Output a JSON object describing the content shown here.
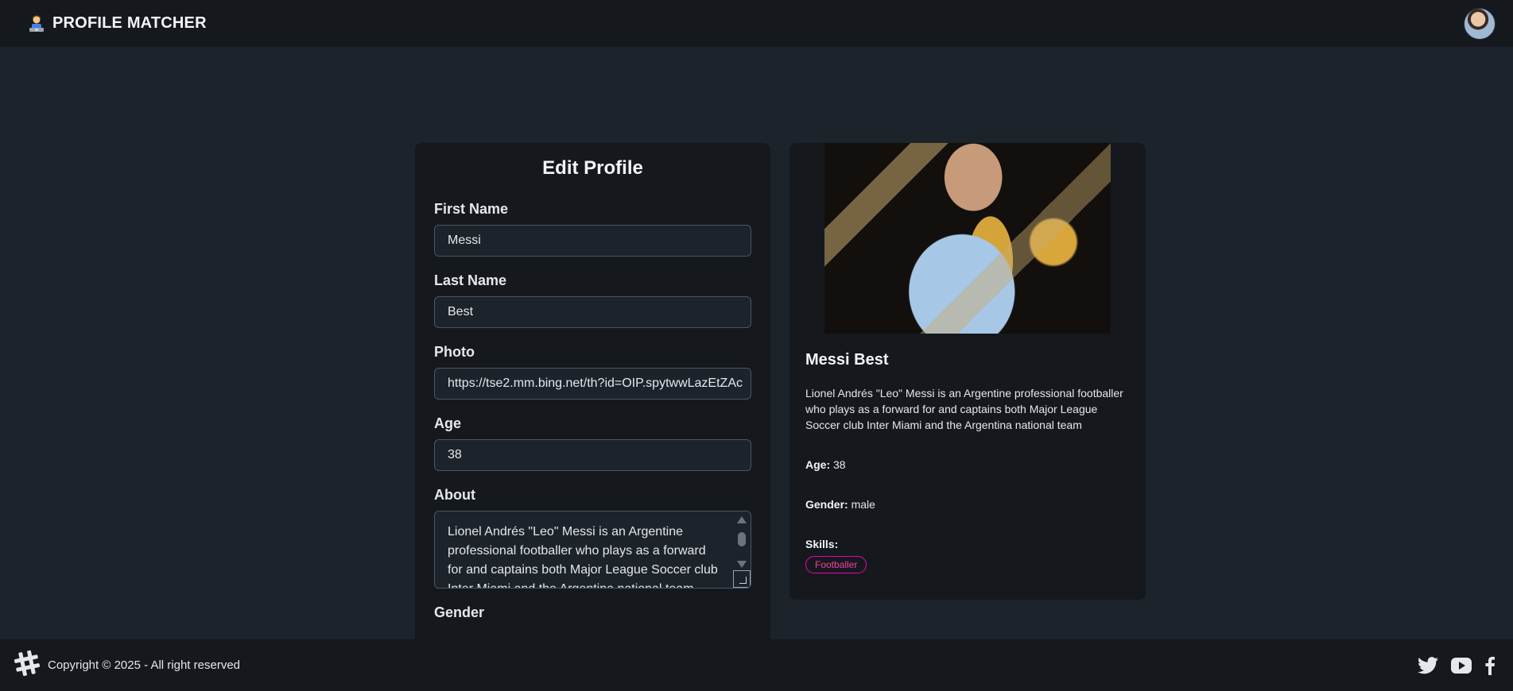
{
  "navbar": {
    "brand_title": "PROFILE MATCHER",
    "brand_icon": "person-at-laptop-icon",
    "avatar": "user-avatar"
  },
  "edit_form": {
    "title": "Edit Profile",
    "first_name": {
      "label": "First Name",
      "value": "Messi"
    },
    "last_name": {
      "label": "Last Name",
      "value": "Best"
    },
    "photo": {
      "label": "Photo",
      "value": "https://tse2.mm.bing.net/th?id=OIP.spytwwLazEtZAc"
    },
    "age": {
      "label": "Age",
      "value": "38"
    },
    "about": {
      "label": "About",
      "value": "Lionel Andrés \"Leo\" Messi is an Argentine professional footballer who plays as a forward for and captains both Major League Soccer club Inter Miami and the Argentina national team"
    },
    "gender": {
      "label": "Gender"
    }
  },
  "preview": {
    "name": "Messi Best",
    "about": "Lionel Andrés \"Leo\" Messi is an Argentine professional footballer who plays as a forward for and captains both Major League Soccer club Inter Miami and the Argentina national team",
    "age_label": "Age:",
    "age_value": "38",
    "gender_label": "Gender:",
    "gender_value": "male",
    "skills_label": "Skills:",
    "skills": [
      "Footballer"
    ],
    "skill_color": "#f000b8"
  },
  "footer": {
    "logo_icon": "hashtag-logo-icon",
    "copyright": "Copyright © 2025 - All right reserved",
    "social_icons": [
      "twitter-icon",
      "youtube-icon",
      "facebook-icon"
    ]
  },
  "colors": {
    "background": "#1d232a",
    "card": "#15191e",
    "accent": "#f000b8"
  }
}
